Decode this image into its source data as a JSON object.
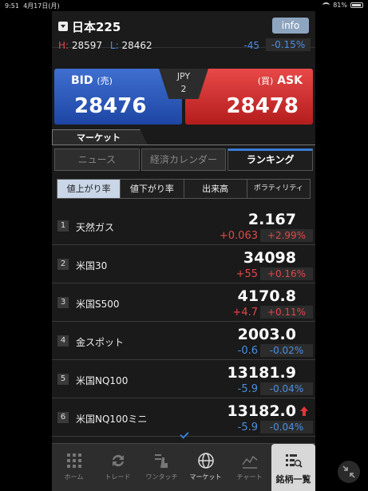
{
  "statusbar": {
    "time": "9:51",
    "date": "4月17日(月)",
    "battery": "81%",
    "battery_level": 0.81
  },
  "header": {
    "symbol": "日本225",
    "info_label": "info",
    "high_label": "H:",
    "high": "28597",
    "low_label": "L:",
    "low": "28462",
    "change": "-45",
    "change_pct": "-0.15%"
  },
  "quote": {
    "bid_label": "BID",
    "bid_sub": "(売)",
    "bid": "28476",
    "ask_label": "ASK",
    "ask_sub": "(買)",
    "ask": "28478",
    "currency": "JPY",
    "spread": "2"
  },
  "market_tab": "マーケット",
  "subtabs": [
    "ニュース",
    "経済カレンダー",
    "ランキング"
  ],
  "filters": [
    "値上がり率",
    "値下がり率",
    "出来高",
    "ボラティリティ"
  ],
  "rows": [
    {
      "rank": "1",
      "name": "天然ガス",
      "price": "2.167",
      "change": "+0.063",
      "pct": "+2.99%"
    },
    {
      "rank": "2",
      "name": "米国30",
      "price": "34098",
      "change": "+55",
      "pct": "+0.16%"
    },
    {
      "rank": "3",
      "name": "米国S500",
      "price": "4170.8",
      "change": "+4.7",
      "pct": "+0.11%"
    },
    {
      "rank": "4",
      "name": "金スポット",
      "price": "2003.0",
      "change": "-0.6",
      "pct": "-0.02%"
    },
    {
      "rank": "5",
      "name": "米国NQ100",
      "price": "13181.9",
      "change": "-5.9",
      "pct": "-0.04%"
    },
    {
      "rank": "6",
      "name": "米国NQ100ミニ",
      "price": "13182.0",
      "change": "-5.9",
      "pct": "-0.04%"
    }
  ],
  "nav": [
    "ホーム",
    "トレード",
    "ワンタッチ",
    "マーケット",
    "チャート",
    "銘柄一覧"
  ],
  "colors": {
    "up": "#e2474b",
    "down": "#4a8fe0",
    "bid": "#2a55b8",
    "ask": "#d02b2b",
    "accent": "#3a7bd5"
  }
}
